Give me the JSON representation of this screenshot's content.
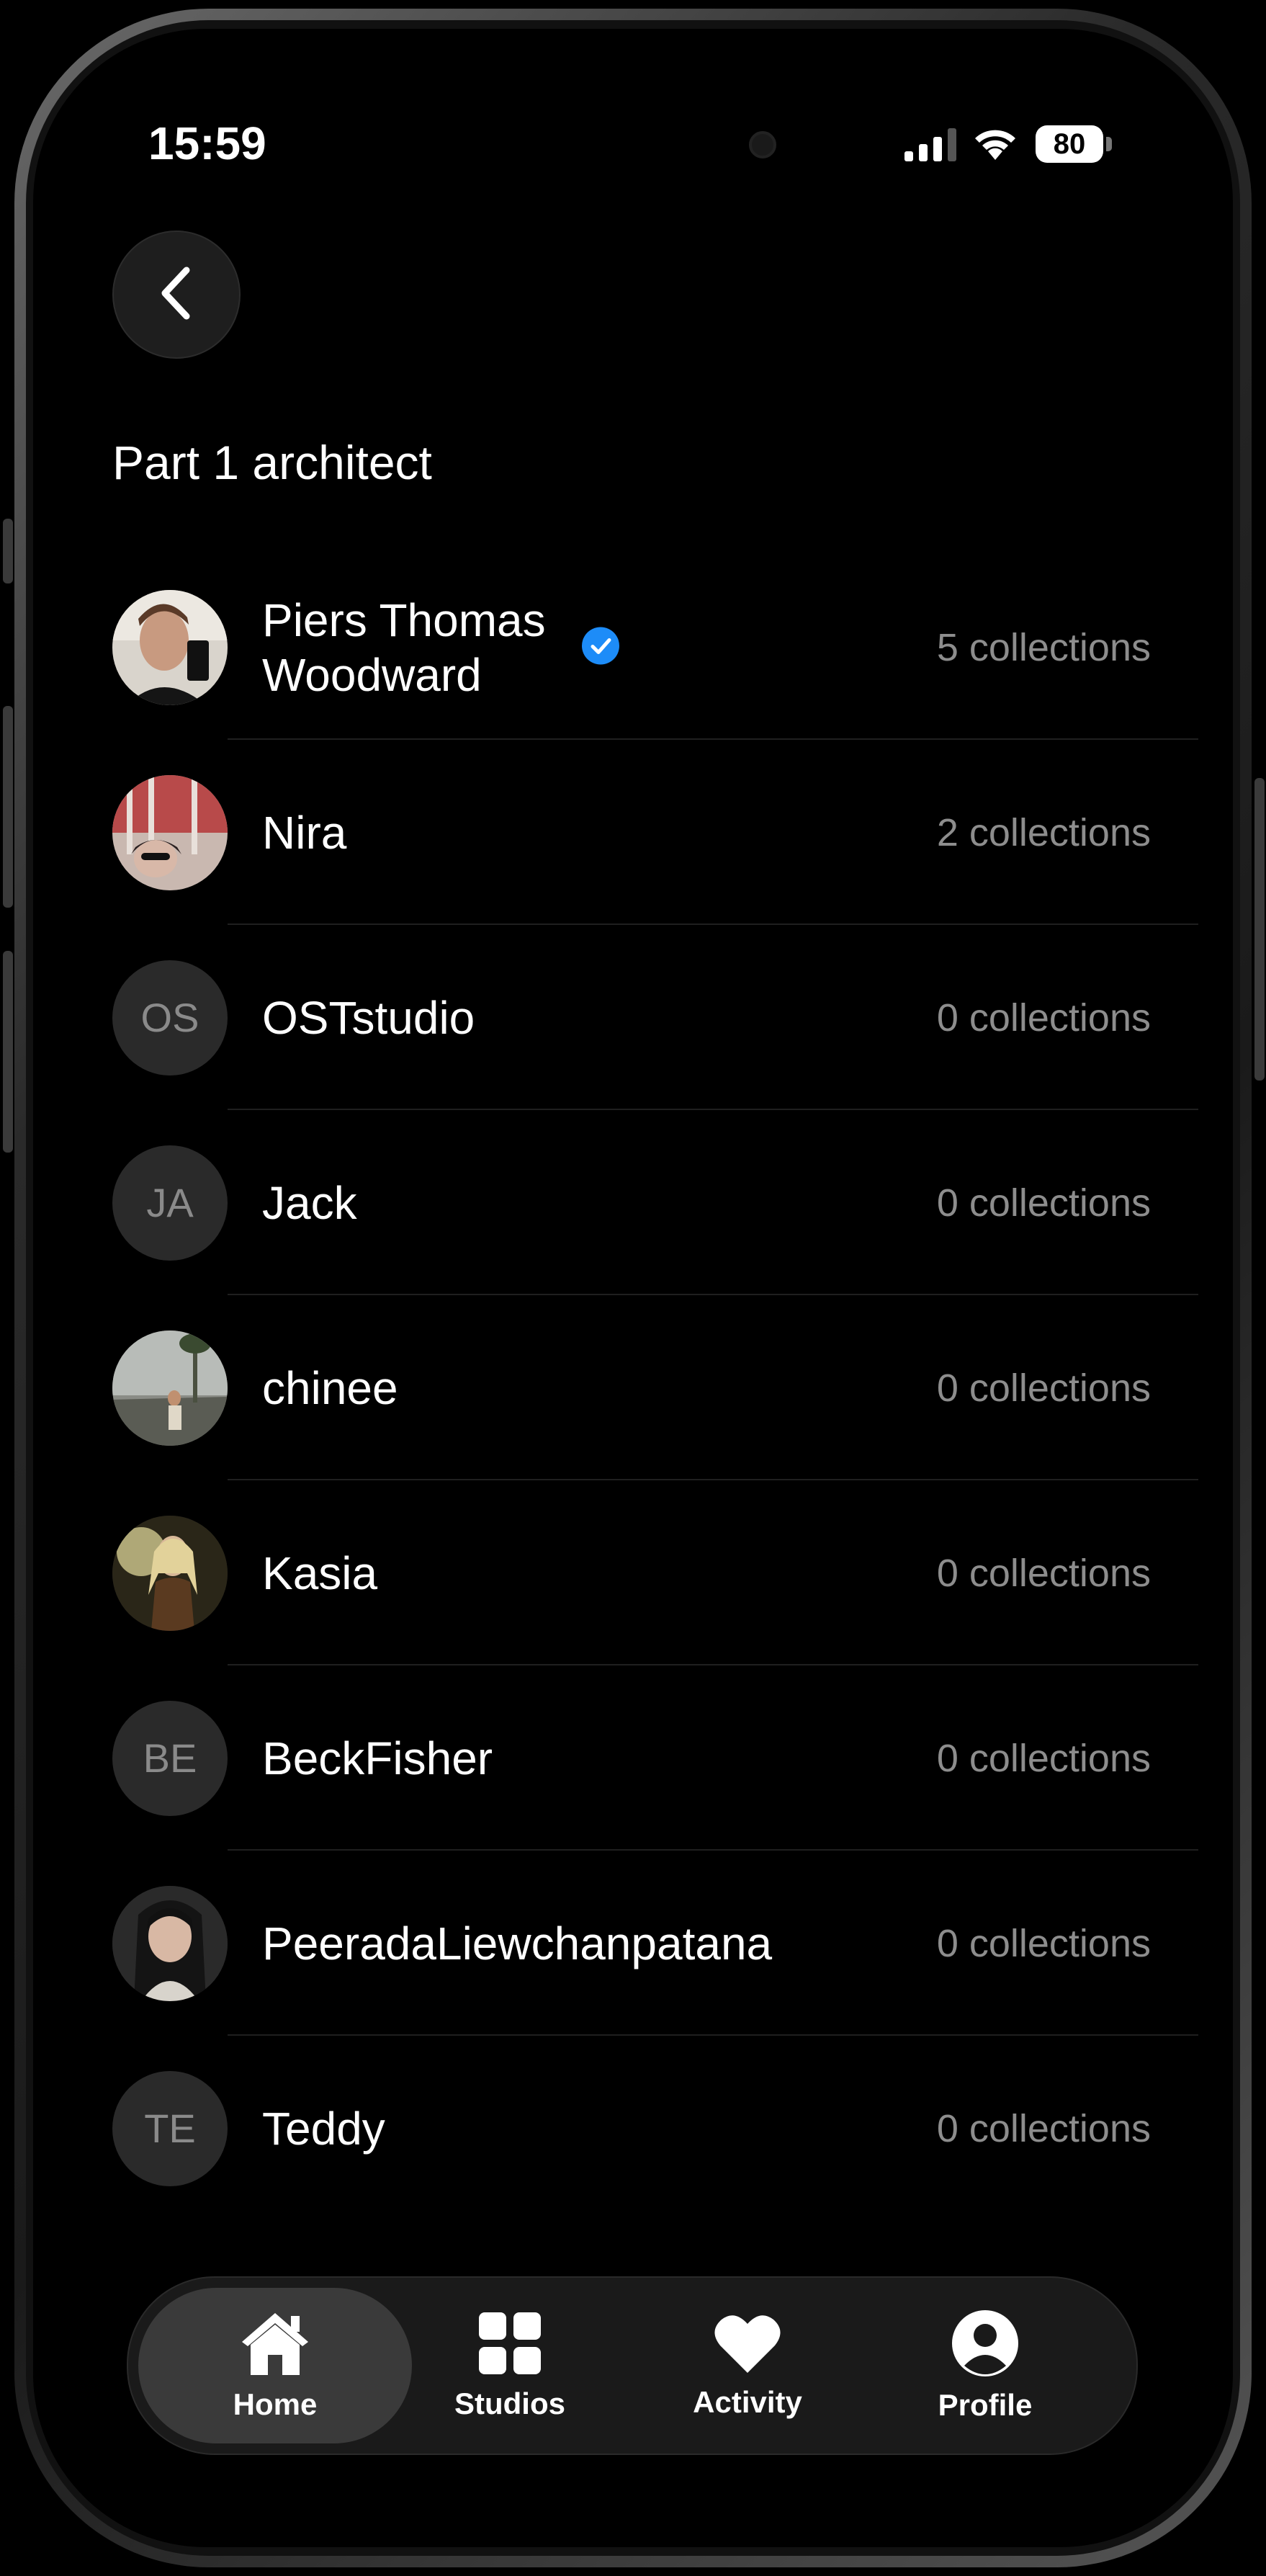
{
  "status_bar": {
    "time": "15:59",
    "battery": "80"
  },
  "header": {
    "back_icon": "chevron-left-icon",
    "title": "Part 1 architect"
  },
  "members": [
    {
      "name_line1": "Piers Thomas",
      "name_line2": "Woodward",
      "verified": true,
      "count": "5 collections",
      "avatar": "photo"
    },
    {
      "name": "Nira",
      "count": "2 collections",
      "avatar": "photo"
    },
    {
      "name": "OSTstudio",
      "initials": "OS",
      "count": "0 collections"
    },
    {
      "name": "Jack",
      "initials": "JA",
      "count": "0 collections"
    },
    {
      "name": "chinee",
      "count": "0 collections",
      "avatar": "photo"
    },
    {
      "name": "Kasia",
      "count": "0 collections",
      "avatar": "photo"
    },
    {
      "name": "BeckFisher",
      "initials": "BE",
      "count": "0 collections"
    },
    {
      "name": "PeeradaLiewchanpatana",
      "count": "0 collections",
      "avatar": "photo"
    },
    {
      "name": "Teddy",
      "initials": "TE",
      "count": "0 collections"
    }
  ],
  "tabs": [
    {
      "label": "Home",
      "icon": "home-icon",
      "active": true
    },
    {
      "label": "Studios",
      "icon": "grid-icon"
    },
    {
      "label": "Activity",
      "icon": "heart-icon"
    },
    {
      "label": "Profile",
      "icon": "profile-icon"
    }
  ],
  "colors": {
    "background": "#000000",
    "verified_badge": "#1d8cf8",
    "secondary_text": "#8d8d8d"
  }
}
